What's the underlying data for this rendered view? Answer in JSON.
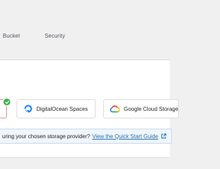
{
  "steps": {
    "bucket": "Bucket",
    "security": "Security"
  },
  "providers": [
    {
      "name": "DigitalOcean Spaces",
      "icon": "digitalocean-icon"
    },
    {
      "name": "Google Cloud Storage",
      "icon": "google-cloud-icon"
    }
  ],
  "notice": {
    "text": "uring your chosen storage provider?",
    "link": "View the Quick Start Guide",
    "link_icon": "external-link-icon"
  },
  "colors": {
    "background": "#f0f0f1",
    "panel": "#ffffff",
    "link": "#2271b1",
    "success": "#46b450",
    "selected_border": "#e88a8a",
    "notice_bg": "#f0f6fc"
  }
}
